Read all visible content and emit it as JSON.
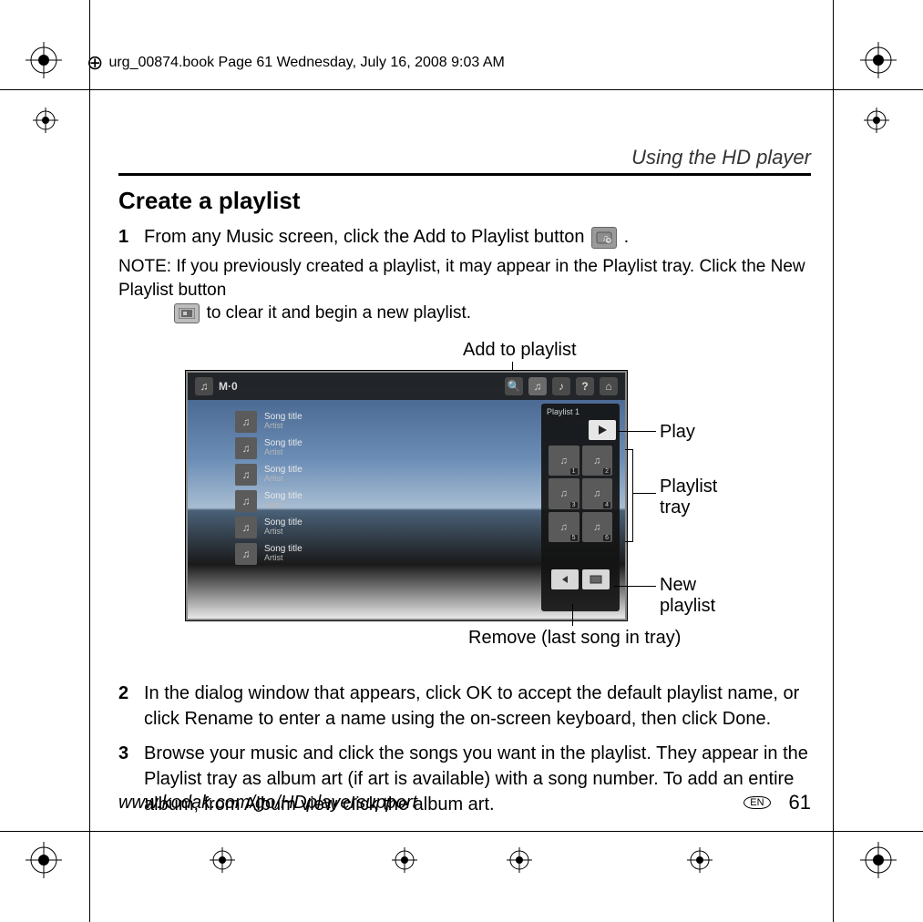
{
  "meta_header": "urg_00874.book  Page 61  Wednesday, July 16, 2008  9:03 AM",
  "section": "Using the HD player",
  "title": "Create a playlist",
  "steps": {
    "1": {
      "num": "1",
      "text_a": "From any Music screen, click the Add to Playlist button ",
      "text_b": "."
    },
    "2": {
      "num": "2",
      "text": "In the dialog window that appears, click OK to accept the default playlist name, or click Rename to enter a name using the on-screen keyboard, then click Done."
    },
    "3": {
      "num": "3",
      "text": "Browse your music and click the songs you want in the playlist. They appear in the Playlist tray as album art (if art is available) with a song number. To add an entire album, from Album view click the album art."
    }
  },
  "note": {
    "label": "NOTE:  ",
    "text_a": "If you previously created a playlist, it may appear in the Playlist tray. Click the New Playlist button ",
    "text_b": " to clear it and begin a new playlist."
  },
  "callouts": {
    "add": "Add to playlist",
    "play": "Play",
    "tray": "Playlist\ntray",
    "new": "New\nplaylist",
    "remove": "Remove (last song in tray)"
  },
  "screenshot": {
    "breadcrumb": "M·0",
    "playlist_label": "Playlist 1",
    "song_title": "Song title",
    "artist": "Artist"
  },
  "footer": {
    "url": "www.kodak.com/go/HDplayersupport",
    "lang": "EN",
    "page": "61"
  }
}
